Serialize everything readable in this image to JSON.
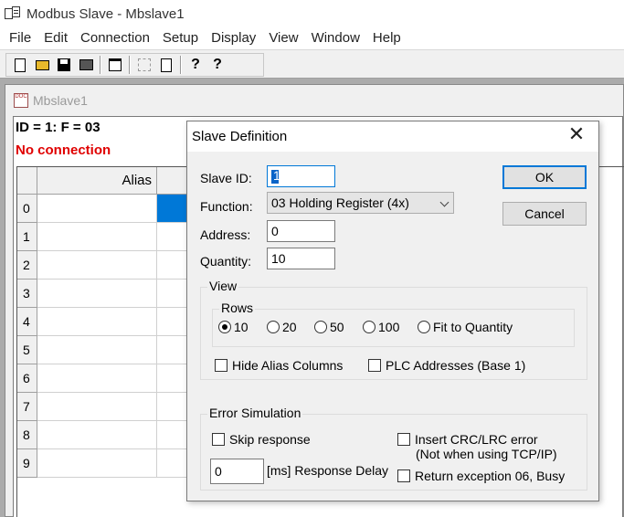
{
  "app": {
    "title": "Modbus Slave - Mbslave1"
  },
  "menu": [
    "File",
    "Edit",
    "Connection",
    "Setup",
    "Display",
    "View",
    "Window",
    "Help"
  ],
  "toolbar": {
    "icons": [
      "new-document-icon",
      "open-folder-icon",
      "save-disk-icon",
      "print-icon",
      "window-icon",
      "disabled-grid-icon",
      "clipboard-icon",
      "help-icon",
      "context-help-icon"
    ],
    "help_glyph": "?",
    "context_help_glyph": "?"
  },
  "child_window": {
    "title": "Mbslave1",
    "icon_text": "DOC",
    "status_id": "ID = 1: F = 03",
    "status_connection": "No connection",
    "status_connection_color": "#e00000",
    "grid": {
      "alias_header": "Alias",
      "rows": [
        "0",
        "1",
        "2",
        "3",
        "4",
        "5",
        "6",
        "7",
        "8",
        "9"
      ],
      "selected_row": 0,
      "selection_color": "#0078d7"
    }
  },
  "dialog": {
    "title": "Slave Definition",
    "close_glyph": "✕",
    "slave_id_label": "Slave ID:",
    "slave_id_value": "1",
    "function_label": "Function:",
    "function_value": "03 Holding Register (4x)",
    "address_label": "Address:",
    "address_value": "0",
    "quantity_label": "Quantity:",
    "quantity_value": "10",
    "ok_label": "OK",
    "cancel_label": "Cancel",
    "view_group": {
      "title": "View",
      "rows_title": "Rows",
      "options": [
        "10",
        "20",
        "50",
        "100",
        "Fit to Quantity"
      ],
      "selected": "10",
      "hide_alias_label": "Hide Alias Columns",
      "hide_alias_checked": false,
      "plc_addresses_label": "PLC Addresses (Base 1)",
      "plc_addresses_checked": false
    },
    "error_group": {
      "title": "Error Simulation",
      "skip_response_label": "Skip response",
      "skip_response_checked": false,
      "insert_crc_label": "Insert CRC/LRC error",
      "insert_crc_note": "(Not when using TCP/IP)",
      "insert_crc_checked": false,
      "delay_value": "0",
      "delay_label": "[ms] Response Delay",
      "return_exception_label": "Return exception 06, Busy",
      "return_exception_checked": false
    }
  }
}
